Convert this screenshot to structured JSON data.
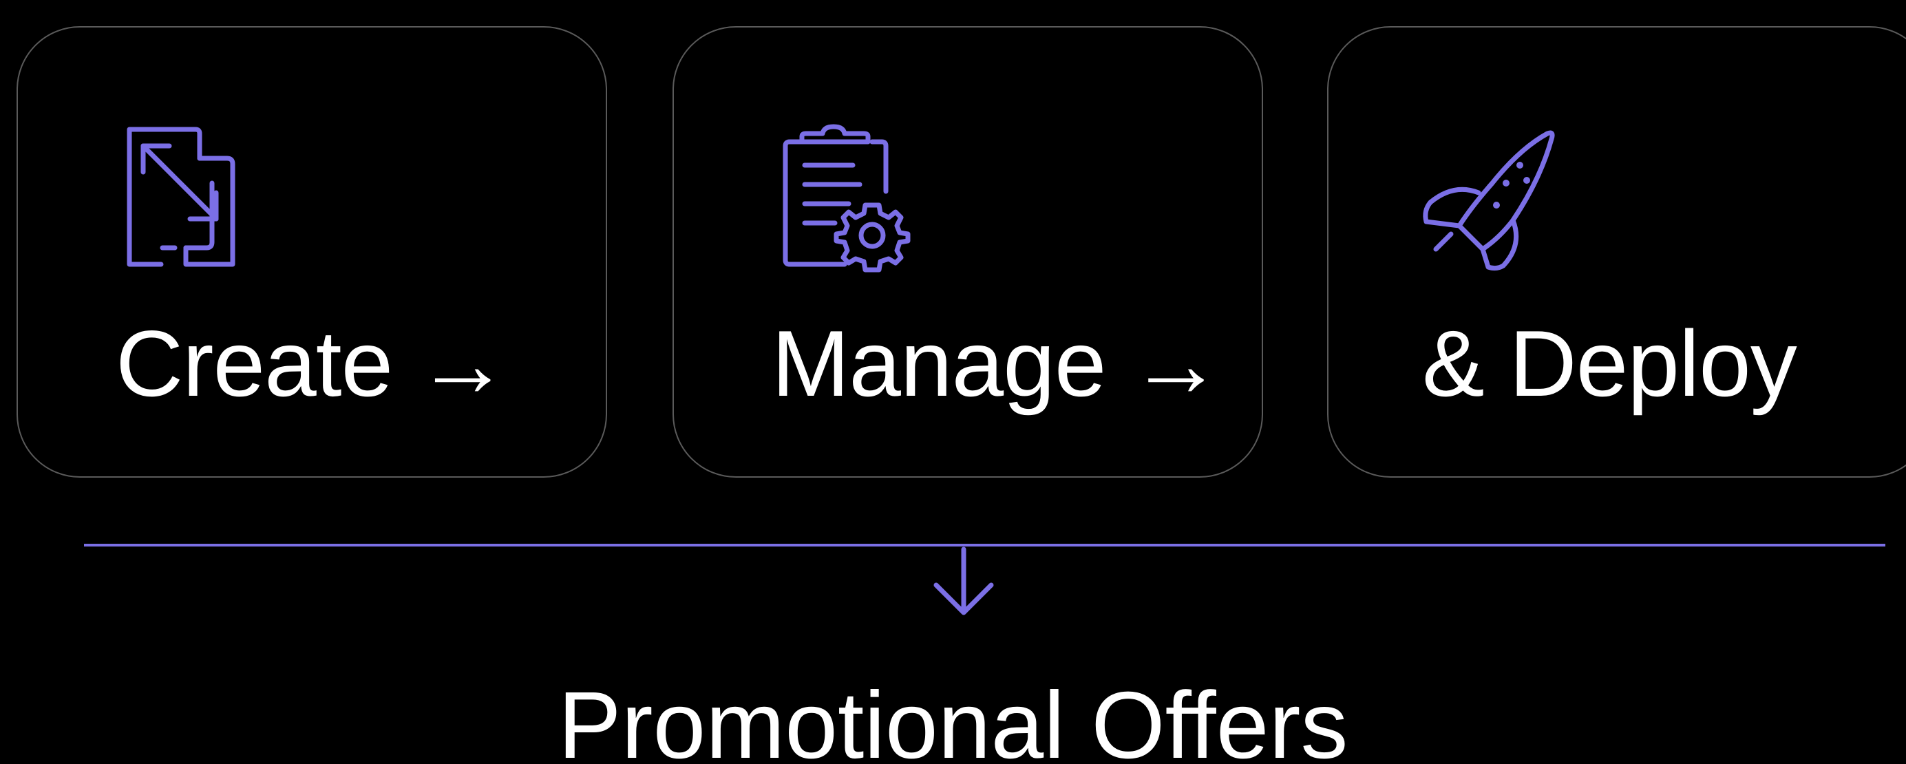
{
  "colors": {
    "background": "#000000",
    "accent": "#7b6fe6",
    "card_border": "#5a5a5a",
    "text": "#ffffff"
  },
  "cards": [
    {
      "label": "Create",
      "arrow": "→",
      "icon": "resize-windows-icon"
    },
    {
      "label": "Manage",
      "arrow": "→",
      "icon": "clipboard-gear-icon"
    },
    {
      "label": "& Deploy",
      "arrow": "",
      "icon": "rocket-icon"
    }
  ],
  "flow": {
    "connector_icon": "arrow-down-icon",
    "result_label": "Promotional Offers"
  }
}
